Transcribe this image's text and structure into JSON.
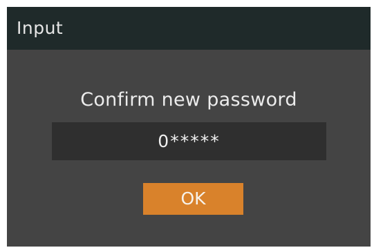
{
  "dialog": {
    "title": "Input",
    "prompt": "Confirm new password",
    "password_value": "0*****",
    "ok_label": "OK"
  },
  "colors": {
    "title_bar": "#1f2a2a",
    "body": "#444444",
    "field": "#2f2f2f",
    "accent": "#d9822b"
  }
}
